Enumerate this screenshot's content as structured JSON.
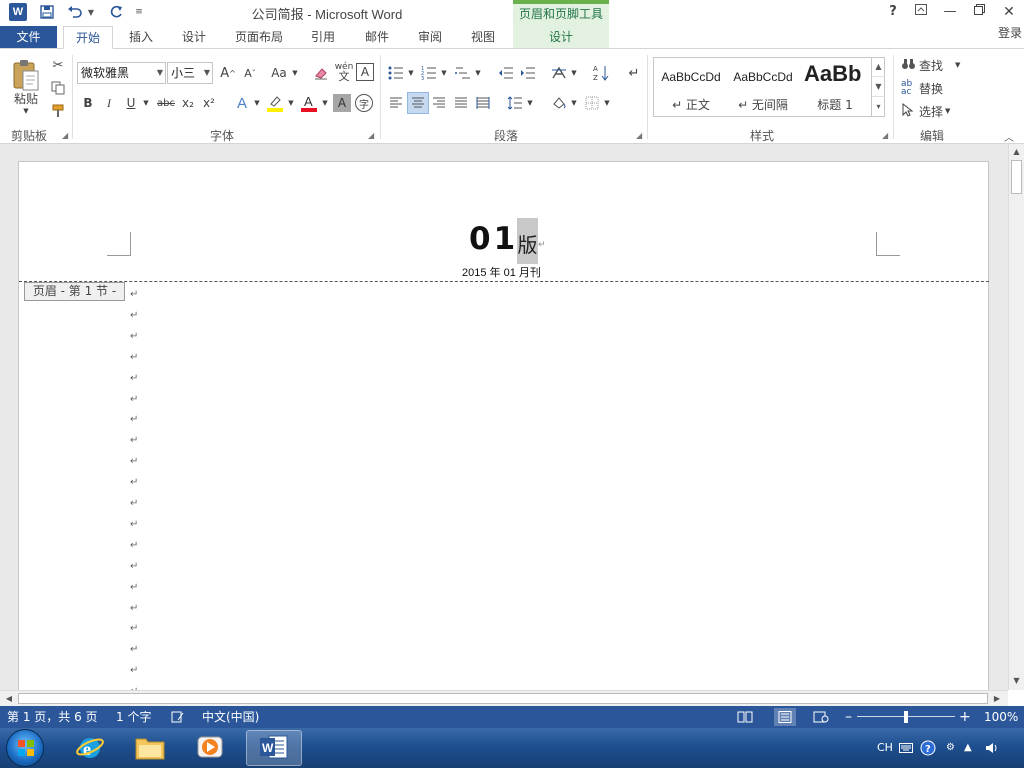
{
  "window": {
    "title": "公司简报 - Microsoft Word",
    "app_icon": "W",
    "context_tab_group": "页眉和页脚工具",
    "help": "?",
    "login": "登录"
  },
  "tabs": {
    "file": "文件",
    "items": [
      "开始",
      "插入",
      "设计",
      "页面布局",
      "引用",
      "邮件",
      "审阅",
      "视图"
    ],
    "context": "设计",
    "active": "开始"
  },
  "ribbon": {
    "clipboard": {
      "label": "剪贴板",
      "paste": "粘贴"
    },
    "font": {
      "label": "字体",
      "font_name": "微软雅黑",
      "font_size": "小三",
      "bold": "B",
      "italic": "I",
      "underline": "U",
      "strike": "abc",
      "subscript": "x₂",
      "superscript": "x²",
      "change_case": "Aa",
      "pinyin": "wén",
      "border_char": "A"
    },
    "paragraph": {
      "label": "段落"
    },
    "styles": {
      "label": "样式",
      "items": [
        {
          "sample": "AaBbCcDd",
          "name": "↵ 正文"
        },
        {
          "sample": "AaBbCcDd",
          "name": "↵ 无间隔"
        },
        {
          "sample": "AaBb",
          "name": "标题 1"
        }
      ]
    },
    "editing": {
      "label": "编辑",
      "find": "查找",
      "replace": "替换",
      "select": "选择"
    }
  },
  "document": {
    "header_number": "01",
    "header_char": "版",
    "date_line": "2015 年 01 月刊",
    "header_tag": "页眉 - 第 1 节 -",
    "para_mark": "↵"
  },
  "status": {
    "page": "第 1 页，共 6 页",
    "words": "1 个字",
    "language": "中文(中国)",
    "zoom": "100%",
    "zoom_level": 0.5
  },
  "taskbar": {
    "tray_lang": "CH"
  },
  "colors": {
    "accent": "#2b579a",
    "context_green": "#217346",
    "context_bg": "#e3f1e1"
  }
}
